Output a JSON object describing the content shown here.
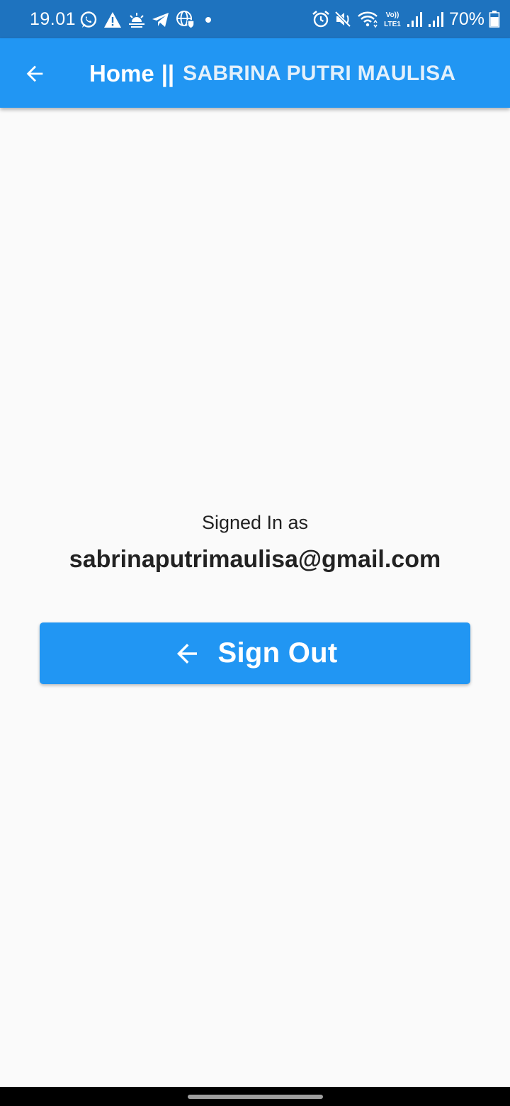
{
  "status_bar": {
    "time": "19.01",
    "battery": "70%",
    "left_icons": [
      "whatsapp-icon",
      "warning-icon",
      "weather-icon",
      "telegram-icon",
      "vpn-globe-icon",
      "dot-icon"
    ],
    "right_icons": [
      "alarm-icon",
      "mute-icon",
      "wifi-icon",
      "volte-icon",
      "signal-icon",
      "signal-icon",
      "battery-icon"
    ],
    "volte_top": "Vo))",
    "volte_bottom": "LTE1"
  },
  "app_bar": {
    "title_home": "Home",
    "title_separator": "||",
    "title_name": "SABRINA PUTRI MAULISA",
    "back_icon": "arrow-back-icon",
    "color": "#2196f3"
  },
  "main": {
    "signed_in_label": "Signed In as",
    "email": "sabrinaputrimaulisa@gmail.com",
    "signout_button": {
      "label": "Sign Out",
      "icon": "arrow-back-icon",
      "color": "#2196f3"
    }
  }
}
